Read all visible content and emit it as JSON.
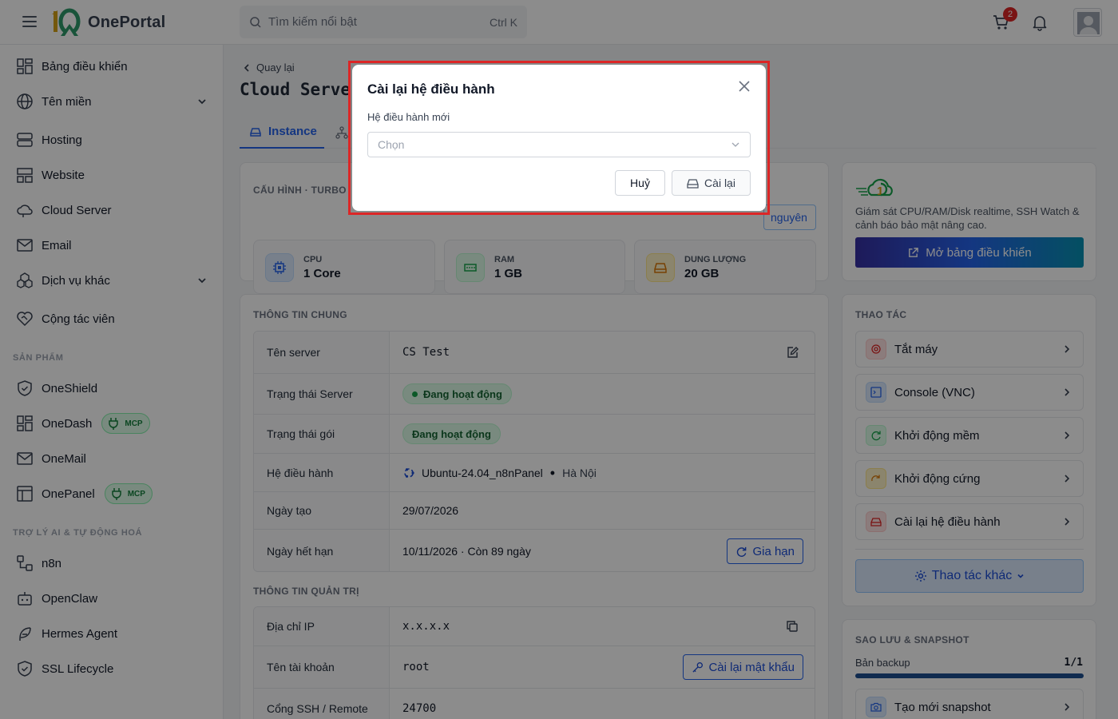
{
  "header": {
    "brand": "OnePortal",
    "search_placeholder": "Tìm kiếm nổi bật",
    "search_shortcut": "Ctrl K",
    "cart_count": "2"
  },
  "sidebar": {
    "items": [
      {
        "label": "Bảng điều khiển",
        "icon": "dashboard-icon"
      },
      {
        "label": "Tên miền",
        "icon": "globe-icon",
        "expandable": true
      },
      {
        "label": "Hosting",
        "icon": "server-icon"
      },
      {
        "label": "Website",
        "icon": "layout-icon"
      },
      {
        "label": "Cloud Server",
        "icon": "cloud-icon"
      },
      {
        "label": "Email",
        "icon": "mail-icon"
      },
      {
        "label": "Dịch vụ khác",
        "icon": "boxes-icon",
        "expandable": true
      },
      {
        "label": "Cộng tác viên",
        "icon": "handshake-icon"
      }
    ],
    "products_label": "SẢN PHẨM",
    "products": [
      {
        "label": "OneShield",
        "icon": "shield-icon"
      },
      {
        "label": "OneDash",
        "icon": "dashboard-icon",
        "badge": "MCP"
      },
      {
        "label": "OneMail",
        "icon": "mail-icon"
      },
      {
        "label": "OnePanel",
        "icon": "panel-icon",
        "badge": "MCP"
      }
    ],
    "ai_label": "TRỢ LÝ AI & TỰ ĐỘNG HOÁ",
    "ai_items": [
      {
        "label": "n8n",
        "icon": "workflow-icon"
      },
      {
        "label": "OpenClaw",
        "icon": "bot-icon"
      },
      {
        "label": "Hermes Agent",
        "icon": "feather-icon"
      },
      {
        "label": "SSL Lifecycle",
        "icon": "shield-check-icon"
      }
    ]
  },
  "page": {
    "back_label": "Quay lại",
    "title": "Cloud Server",
    "tabs": [
      {
        "label": "Instance"
      }
    ]
  },
  "config": {
    "title": "CẤU HÌNH · TURBO",
    "resources_button": "nguyên",
    "specs": [
      {
        "label": "CPU",
        "value": "1 Core"
      },
      {
        "label": "RAM",
        "value": "1 GB"
      },
      {
        "label": "DUNG LƯỢNG",
        "value": "20 GB"
      }
    ]
  },
  "general": {
    "title": "THÔNG TIN CHUNG",
    "rows": [
      {
        "label": "Tên server",
        "value": "CS Test"
      },
      {
        "label": "Trạng thái Server",
        "value": "Đang hoạt động"
      },
      {
        "label": "Trạng thái gói",
        "value": "Đang hoạt động"
      },
      {
        "label": "Hệ điều hành",
        "value": "Ubuntu-24.04_n8nPanel",
        "location": "Hà Nội"
      },
      {
        "label": "Ngày tạo",
        "value": "29/07/2026"
      },
      {
        "label": "Ngày hết hạn",
        "value": "10/11/2026 · Còn 89 ngày",
        "button": "Gia hạn"
      }
    ]
  },
  "admin": {
    "title": "THÔNG TIN QUẢN TRỊ",
    "rows": [
      {
        "label": "Địa chỉ IP",
        "value": "x.x.x.x"
      },
      {
        "label": "Tên tài khoản",
        "value": "root",
        "button": "Cài lại mật khẩu"
      },
      {
        "label": "Cổng SSH / Remote",
        "value": "24700"
      }
    ]
  },
  "monitor": {
    "description": "Giám sát CPU/RAM/Disk realtime, SSH Watch & cảnh báo bảo mật nâng cao.",
    "button": "Mở bảng điều khiển"
  },
  "actions": {
    "title": "THAO TÁC",
    "items": [
      {
        "label": "Tắt máy",
        "color": "#dc2626"
      },
      {
        "label": "Console (VNC)",
        "color": "#2563eb"
      },
      {
        "label": "Khởi động mềm",
        "color": "#16a34a"
      },
      {
        "label": "Khởi động cứng",
        "color": "#d97706"
      },
      {
        "label": "Cài lại hệ điều hành",
        "color": "#dc2626"
      }
    ],
    "more_button": "Thao tác khác"
  },
  "backup": {
    "title": "SAO LƯU & SNAPSHOT",
    "label": "Bản backup",
    "count": "1/1",
    "progress": 1.0,
    "snapshot_button": "Tạo mới snapshot"
  },
  "modal": {
    "title": "Cài lại hệ điều hành",
    "field_label": "Hệ điều hành mới",
    "select_placeholder": "Chọn",
    "cancel": "Huỷ",
    "confirm": "Cài lại"
  }
}
